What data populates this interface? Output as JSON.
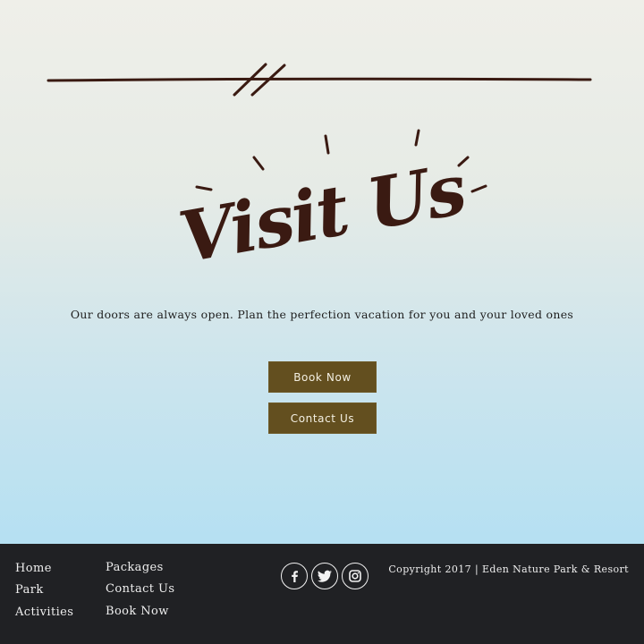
{
  "hero": {
    "title": "Visit Us",
    "tagline": "Our doors are always open. Plan the perfection vacation for you and your loved ones",
    "buttons": {
      "book_now": "Book Now",
      "contact_us": "Contact Us"
    }
  },
  "footer": {
    "nav_col1": [
      "Home",
      "Park",
      "Activities"
    ],
    "nav_col2": [
      "Packages",
      "Contact Us",
      "Book Now"
    ],
    "social": [
      "facebook-icon",
      "twitter-icon",
      "instagram-icon"
    ],
    "copyright": "Copyright 2017 | Eden Nature Park & Resort"
  },
  "colors": {
    "title": "#3a1a12",
    "button_bg": "#634f1f",
    "button_text": "#f3efe2",
    "footer_bg": "#202124",
    "gradient_top": "#efefe9",
    "gradient_bottom": "#b5e0f2"
  }
}
